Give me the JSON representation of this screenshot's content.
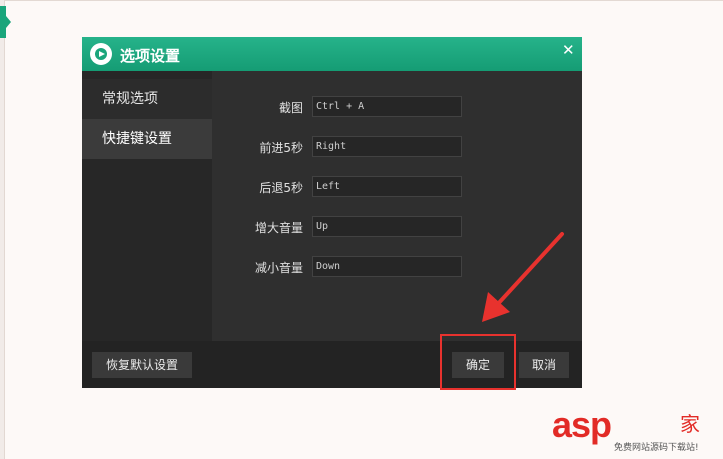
{
  "dialog": {
    "title": "选项设置",
    "close_label": "✕"
  },
  "sidebar": {
    "items": [
      {
        "label": "常规选项"
      },
      {
        "label": "快捷键设置"
      }
    ]
  },
  "shortcuts": [
    {
      "label": "截图",
      "value": "Ctrl + A"
    },
    {
      "label": "前进5秒",
      "value": "Right"
    },
    {
      "label": "后退5秒",
      "value": "Left"
    },
    {
      "label": "增大音量",
      "value": "Up"
    },
    {
      "label": "减小音量",
      "value": "Down"
    }
  ],
  "footer": {
    "restore_label": "恢复默认设置",
    "ok_label": "确定",
    "cancel_label": "取消"
  },
  "watermark": {
    "main": "asp",
    "char": "家",
    "sub": "免费网站源码下载站!"
  },
  "colors": {
    "accent": "#1aa57b",
    "highlight": "#e8322e",
    "dialog_bg": "#2f2f2f"
  }
}
